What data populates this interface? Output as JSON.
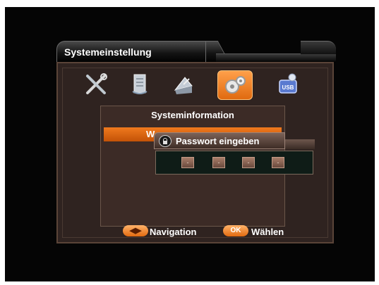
{
  "header": {
    "title": "Systemeinstellung"
  },
  "menu_icons": [
    {
      "name": "tools-icon",
      "active": false
    },
    {
      "name": "document-icon",
      "active": false
    },
    {
      "name": "satellite-dish-icon",
      "active": false
    },
    {
      "name": "gears-icon",
      "active": true
    },
    {
      "name": "usb-icon",
      "active": false
    }
  ],
  "submenu": {
    "title": "Systeminformation",
    "highlighted_item": "W"
  },
  "dialog": {
    "title": "Passwort eingeben",
    "pins": [
      "-",
      "-",
      "-",
      "-"
    ]
  },
  "footer": {
    "nav_button": "◀▶",
    "nav_label": "Navigation",
    "ok_button": "OK",
    "ok_label": "Wählen"
  },
  "colors": {
    "accent": "#e97317",
    "panel": "#2f2320",
    "background": "#050505"
  }
}
